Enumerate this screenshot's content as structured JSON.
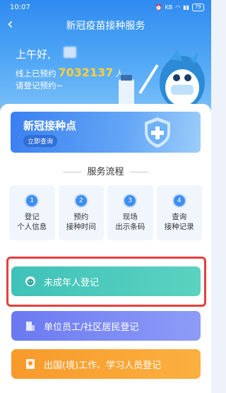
{
  "status": {
    "time": "10:07",
    "net": "0.01\nKB/s",
    "battery": "79"
  },
  "nav": {
    "title": "新冠疫苗接种服务",
    "back_icon": "chevron-left-icon"
  },
  "hero": {
    "greeting": "上午好,",
    "count_prefix": "线上已预约",
    "count_value": "7032137",
    "count_unit": "人",
    "invite": "请登记预约~"
  },
  "site_card": {
    "title": "新冠接种点",
    "button": "立即查询"
  },
  "process": {
    "title": "服务流程",
    "steps": [
      {
        "num": "1",
        "label": "登记\n个人信息"
      },
      {
        "num": "2",
        "label": "预约\n接种时间"
      },
      {
        "num": "3",
        "label": "现场\n出示条码"
      },
      {
        "num": "4",
        "label": "查询\n接种记录"
      }
    ]
  },
  "buttons": {
    "minor": "未成年人登记",
    "staff": "单位员工/社区居民登记",
    "abroad": "出国(境)工作、学习人员登记"
  },
  "colors": {
    "accent": "#3e8ef0",
    "highlight": "#e5403d"
  }
}
